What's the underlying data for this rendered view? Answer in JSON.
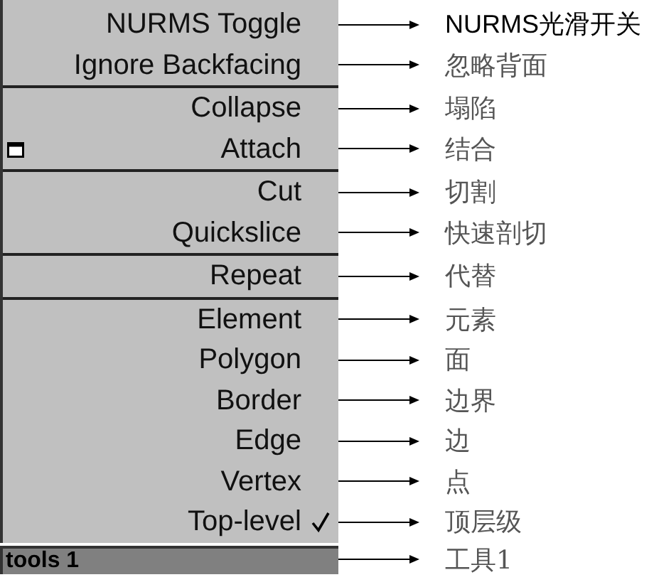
{
  "menu": {
    "groups": [
      {
        "items": [
          {
            "label": "NURMS Toggle",
            "annotation": "NURMS光滑开关",
            "checked": false
          },
          {
            "label": "Ignore Backfacing",
            "annotation": "忽略背面",
            "checked": false
          }
        ]
      },
      {
        "items": [
          {
            "label": "Collapse",
            "annotation": "塌陷",
            "checked": false
          },
          {
            "label": "Attach",
            "annotation": "结合",
            "checked": false,
            "kind": "windowed"
          }
        ]
      },
      {
        "items": [
          {
            "label": "Cut",
            "annotation": "切割",
            "checked": false
          },
          {
            "label": "Quickslice",
            "annotation": "快速剖切",
            "checked": false
          }
        ]
      },
      {
        "items": [
          {
            "label": "Repeat",
            "annotation": "代替",
            "checked": false
          }
        ]
      },
      {
        "items": [
          {
            "label": "Element",
            "annotation": "元素",
            "checked": false
          },
          {
            "label": "Polygon",
            "annotation": "面",
            "checked": false
          },
          {
            "label": "Border",
            "annotation": "边界",
            "checked": false
          },
          {
            "label": "Edge",
            "annotation": "边",
            "checked": false
          },
          {
            "label": "Vertex",
            "annotation": "点",
            "checked": false
          },
          {
            "label": "Top-level",
            "annotation": "顶层级",
            "checked": true
          }
        ]
      }
    ],
    "footer": {
      "label": "tools 1",
      "annotation": "工具1"
    }
  }
}
